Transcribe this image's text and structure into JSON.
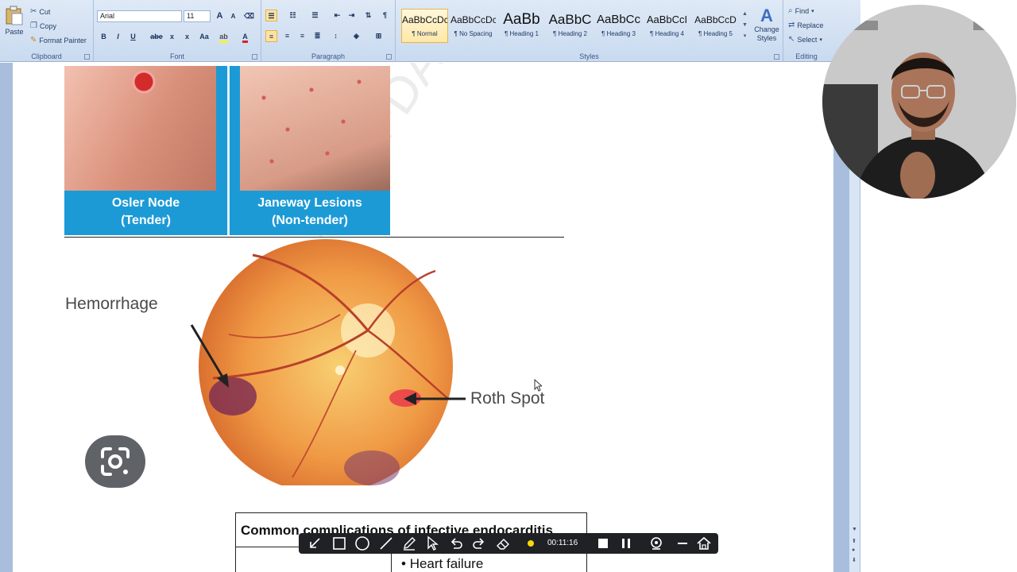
{
  "ribbon": {
    "clipboard": {
      "paste_label": "Paste",
      "cut_label": "Cut",
      "copy_label": "Copy",
      "format_painter_label": "Format Painter",
      "group_label": "Clipboard"
    },
    "font": {
      "font_name": "Arial",
      "font_size": "11",
      "group_label": "Font",
      "bold": "B",
      "italic": "I",
      "underline": "U",
      "strikethrough": "abe",
      "subscript": "x",
      "superscript": "x",
      "change_case": "Aa",
      "grow_font": "A",
      "shrink_font": "A"
    },
    "paragraph": {
      "group_label": "Paragraph",
      "pilcrow": "¶"
    },
    "styles": {
      "group_label": "Styles",
      "items": [
        {
          "sample": "AaBbCcDc",
          "name": "¶ Normal"
        },
        {
          "sample": "AaBbCcDc",
          "name": "¶ No Spacing"
        },
        {
          "sample": "AaBb",
          "name": "¶ Heading 1"
        },
        {
          "sample": "AaBbC",
          "name": "¶ Heading 2"
        },
        {
          "sample": "AaBbCc",
          "name": "¶ Heading 3"
        },
        {
          "sample": "AaBbCcI",
          "name": "¶ Heading 4"
        },
        {
          "sample": "AaBbCcD",
          "name": "¶ Heading 5"
        }
      ],
      "change_styles_label": "Change Styles"
    },
    "editing": {
      "group_label": "Editing",
      "find_label": "Find",
      "replace_label": "Replace",
      "select_label": "Select"
    }
  },
  "document": {
    "osler_caption": [
      "Osler Node",
      "(Tender)"
    ],
    "janeway_caption": [
      "Janeway Lesions",
      "(Non-tender)"
    ],
    "hemorrhage_label": "Hemorrhage",
    "roth_label": "Roth Spot",
    "watermark": "'N SAFDAR",
    "table_title": "Common complications of infective endocarditis",
    "table_item": "Heart failure"
  },
  "recorder": {
    "time": "00:11:16",
    "dot_color": "#f5d90a"
  }
}
